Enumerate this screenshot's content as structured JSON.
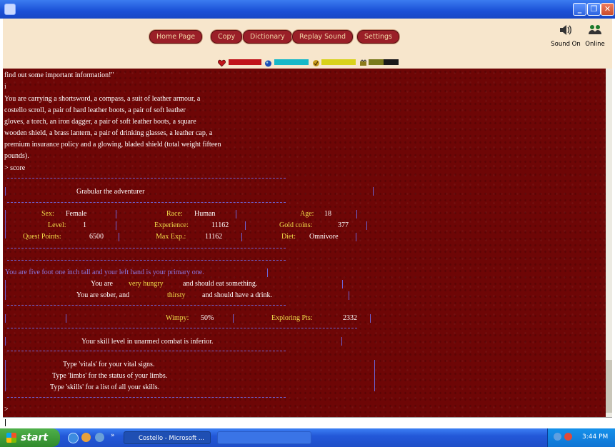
{
  "toolbar": {
    "buttons": [
      "Home Page",
      "Copy",
      "Dictionary",
      "Replay Sound",
      "Settings"
    ],
    "sound_label": "Sound On",
    "online_label": "Online"
  },
  "stats": {
    "health": {
      "color": "#c0141a",
      "fraction": 1.0
    },
    "mana": {
      "color": "#17b8c8",
      "fraction": 1.0
    },
    "stamina": {
      "color": "#d9d21a",
      "fraction": 1.0
    },
    "other": {
      "color": "#7a7a1c",
      "fraction": 0.5
    }
  },
  "game": {
    "lines": [
      "find out some important information!\"",
      "i",
      "You are carrying a shortsword, a compass, a suit of leather armour, a",
      "costello scroll, a pair of hard leather boots, a pair of soft leather",
      "gloves, a torch, an iron dagger, a pair of soft leather boots, a square",
      "wooden shield, a brass lantern, a pair of drinking glasses, a leather cap, a",
      "premium insurance policy and a glowing, bladed shield (total weight fifteen",
      "pounds).",
      "> score"
    ],
    "name": "Grabular the adventurer",
    "sex_label": "Sex:",
    "sex": "Female",
    "race_label": "Race:",
    "race": "Human",
    "age_label": "Age:",
    "age": "18",
    "level_label": "Level:",
    "level": "1",
    "exp_label": "Experience:",
    "exp": "11162",
    "gold_label": "Gold coins:",
    "gold": "377",
    "qp_label": "Quest Points:",
    "qp": "6500",
    "maxexp_label": "Max Exp.:",
    "maxexp": "11162",
    "diet_label": "Diet:",
    "diet": "Omnivore",
    "height_line": "You are five foot one inch tall and your left hand is your primary one.",
    "hunger_pre": "You are",
    "hunger_val": "very hungry",
    "hunger_post": "and should eat something.",
    "sober_pre": "You are sober, and",
    "thirst_val": "thirsty",
    "thirst_post": "and should have a drink.",
    "wimpy_label": "Wimpy:",
    "wimpy": "50%",
    "explore_label": "Exploring Pts:",
    "explore": "2332",
    "skill_line": "Your skill level in unarmed combat is inferior.",
    "help": [
      "Type 'vitals' for your vital signs.",
      "Type 'limbs' for the status of your limbs.",
      "Type 'skills' for a list of all your skills."
    ],
    "prompt": ">"
  },
  "taskbar": {
    "start": "start",
    "task_label": "Costello - Microsoft ...",
    "clock": "3:44 PM"
  }
}
